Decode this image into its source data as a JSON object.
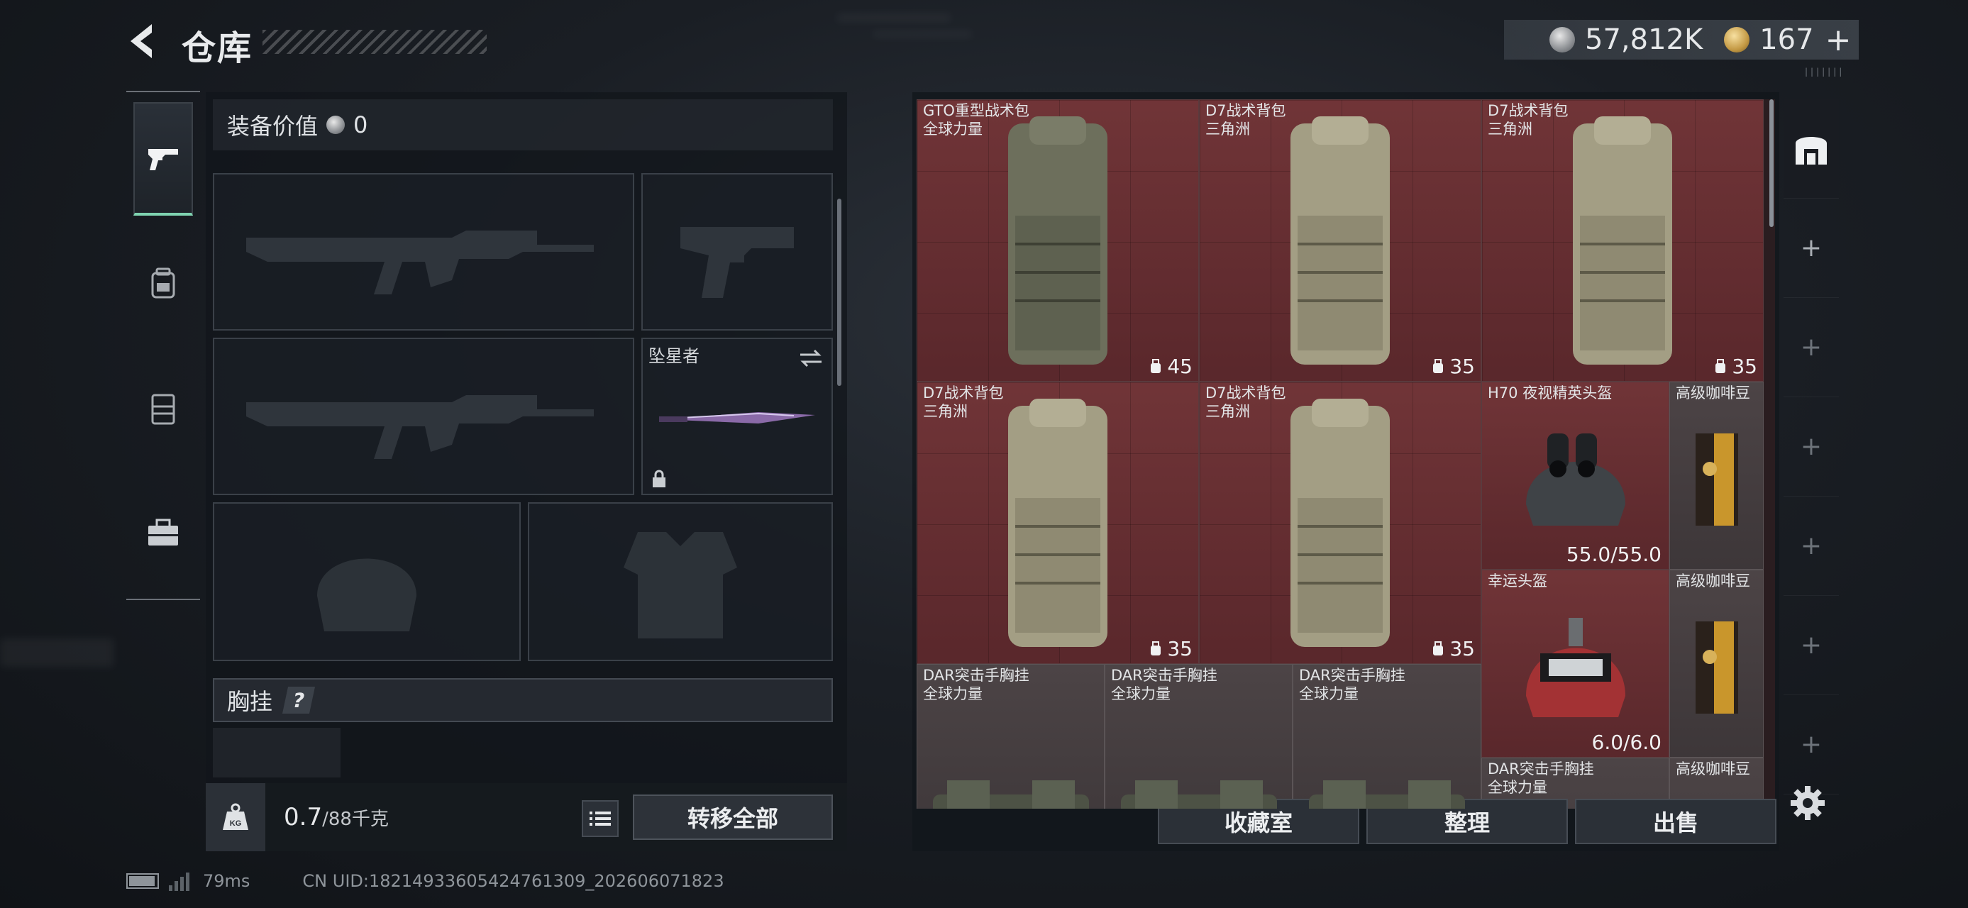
{
  "header": {
    "title": "仓库",
    "currency_silver": "57,812K",
    "currency_gold": "167",
    "currency_plus": "+"
  },
  "equipment": {
    "value_label": "装备价值",
    "value": "0",
    "melee_name": "坠星者",
    "chest_label": "胸挂",
    "help": "?",
    "weight_current": "0.7",
    "weight_max": "/88千克",
    "transfer_all": "转移全部"
  },
  "stash": {
    "items": [
      {
        "name": "GTO重型战术包",
        "sub": "全球力量",
        "count": "45"
      },
      {
        "name": "D7战术背包",
        "sub": "三角洲",
        "count": "35"
      },
      {
        "name": "D7战术背包",
        "sub": "三角洲",
        "count": "35"
      },
      {
        "name": "D7战术背包",
        "sub": "三角洲",
        "count": "35"
      },
      {
        "name": "D7战术背包",
        "sub": "三角洲",
        "count": "35"
      },
      {
        "name": "H70 夜视精英头盔",
        "durability": "55.0/55.0"
      },
      {
        "name": "高级咖啡豆"
      },
      {
        "name": "幸运头盔",
        "durability": "6.0/6.0"
      },
      {
        "name": "高级咖啡豆"
      },
      {
        "name": "DAR突击手胸挂",
        "sub": "全球力量"
      },
      {
        "name": "DAR突击手胸挂",
        "sub": "全球力量"
      },
      {
        "name": "DAR突击手胸挂",
        "sub": "全球力量"
      },
      {
        "name": "DAR突击手胸挂",
        "sub": "全球力量"
      },
      {
        "name": "高级咖啡豆"
      }
    ],
    "actions": {
      "collection": "收藏室",
      "sort": "整理",
      "sell": "出售"
    }
  },
  "status": {
    "ping": "79ms",
    "uid": "CN UID:18214933605424761309_202606071823"
  },
  "colors": {
    "accent_green": "#7fd3b0",
    "item_red": "#7a373b",
    "panel": "#12161b"
  }
}
